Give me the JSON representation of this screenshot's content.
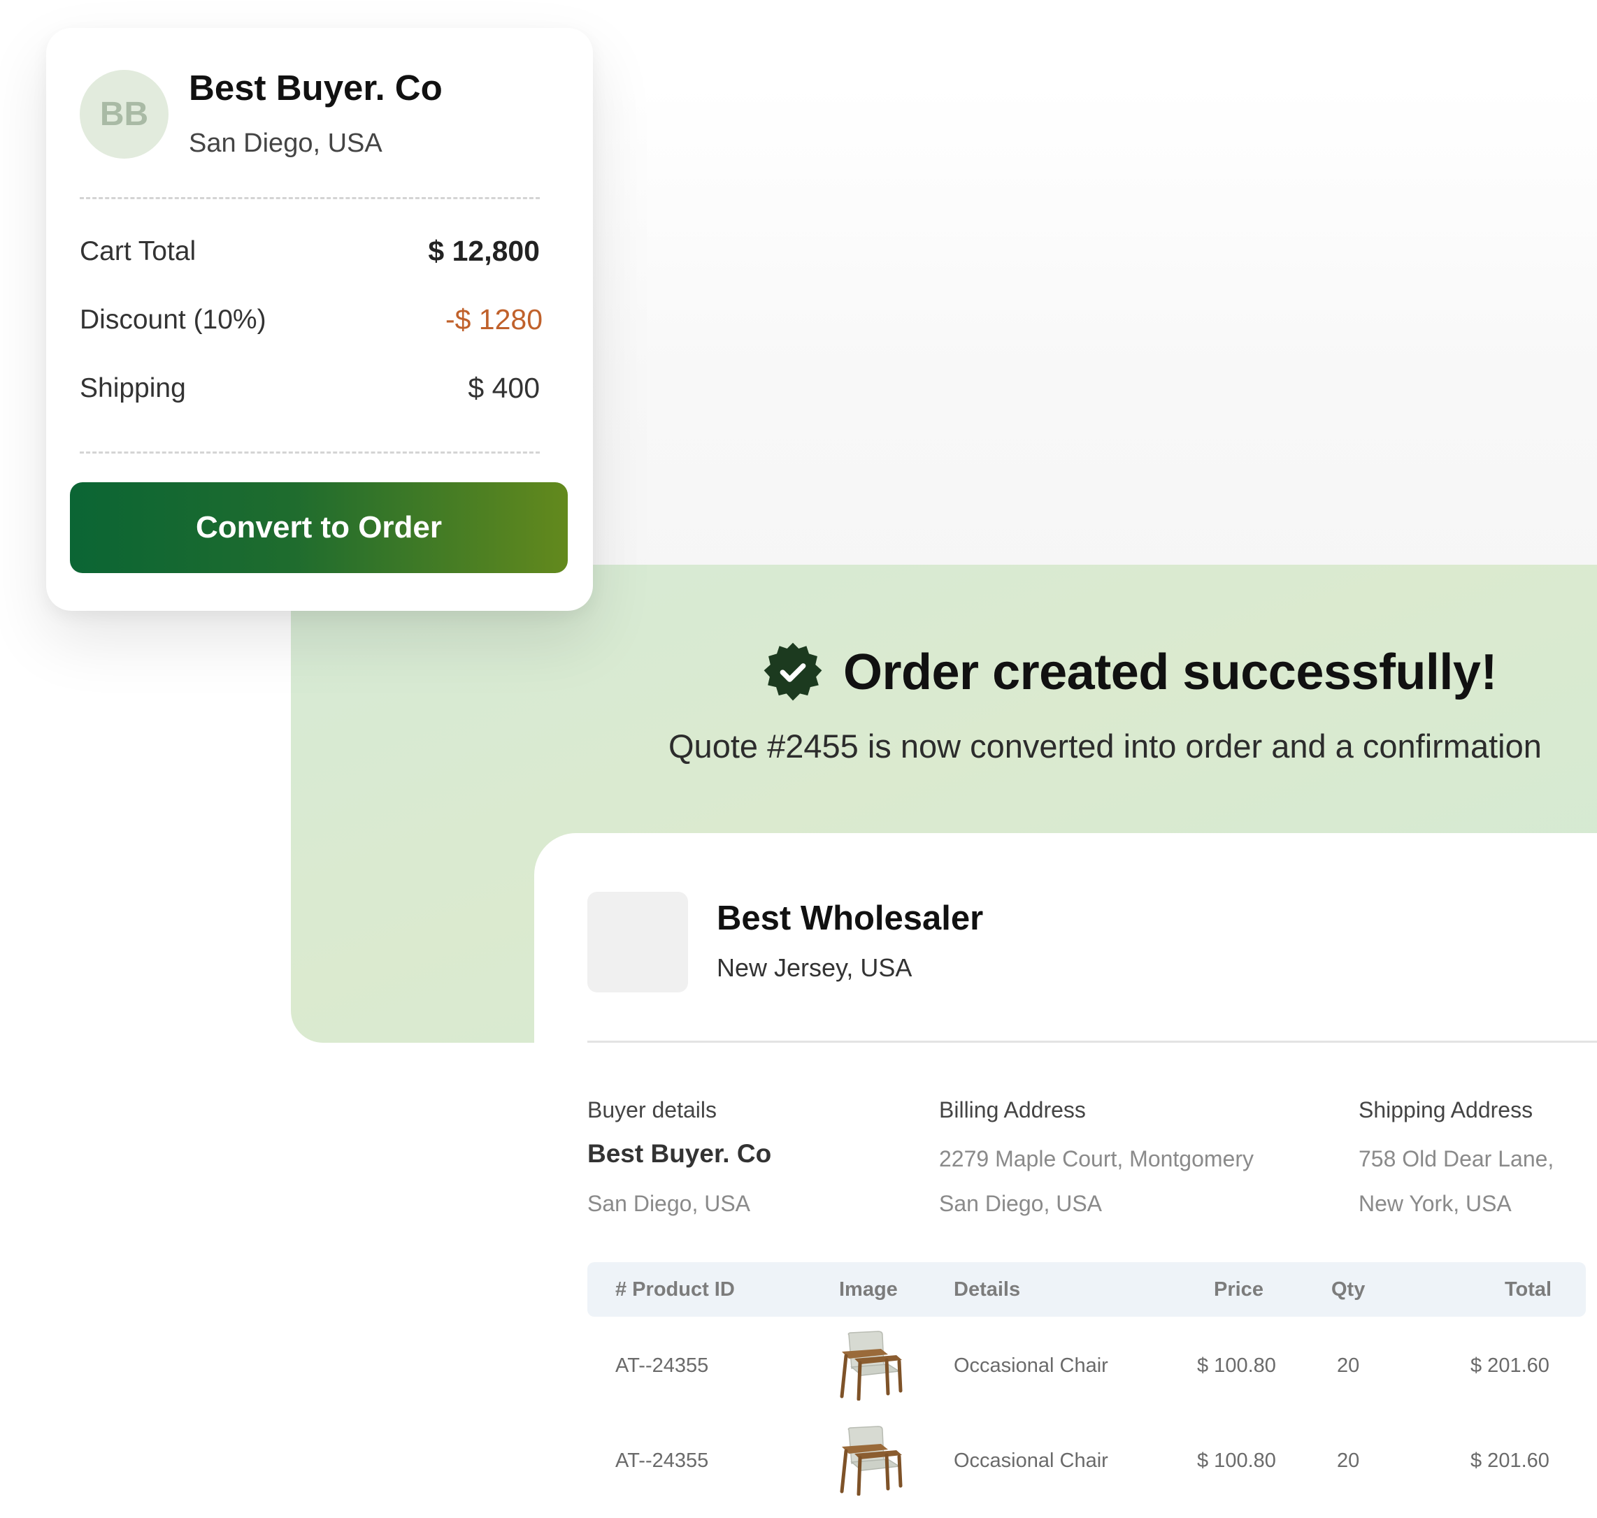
{
  "quote_card": {
    "avatar_initials": "BB",
    "buyer_name": "Best Buyer. Co",
    "buyer_location": "San Diego, USA",
    "rows": [
      {
        "label": "Cart Total",
        "value": "$ 12,800"
      },
      {
        "label": "Discount (10%)",
        "value": "-$ 1280"
      },
      {
        "label": "Shipping",
        "value": "$ 400"
      }
    ],
    "convert_button": "Convert to Order"
  },
  "success": {
    "icon": "check-badge-icon",
    "title": "Order created successfully!",
    "message": "Quote #2455 is now converted into order and a confirmation"
  },
  "order": {
    "seller_name": "Best Wholesaler",
    "seller_location": "New Jersey, USA",
    "buyer_details": {
      "label": "Buyer details",
      "name": "Best Buyer. Co",
      "location": "San Diego, USA"
    },
    "billing_address": {
      "label": "Billing Address",
      "line1": "2279 Maple Court, Montgomery",
      "line2": "San Diego, USA"
    },
    "shipping_address": {
      "label": "Shipping Address",
      "line1": "758 Old Dear Lane,",
      "line2": "New York, USA"
    },
    "table": {
      "headers": [
        "# Product ID",
        "Image",
        "Details",
        "Price",
        "Qty",
        "Total"
      ],
      "rows": [
        {
          "product_id": "AT--24355",
          "image": "chair-icon",
          "details": "Occasional Chair",
          "price": "$ 100.80",
          "qty": "20",
          "total": "$ 201.60"
        },
        {
          "product_id": "AT--24355",
          "image": "chair-icon",
          "details": "Occasional Chair",
          "price": "$ 100.80",
          "qty": "20",
          "total": "$ 201.60"
        }
      ]
    }
  },
  "colors": {
    "accent_green_dark": "#0b6534",
    "accent_green_light": "#63891d",
    "success_panel": "#d6ead5",
    "badge": "#1c3a1f",
    "discount": "#c0612b"
  }
}
